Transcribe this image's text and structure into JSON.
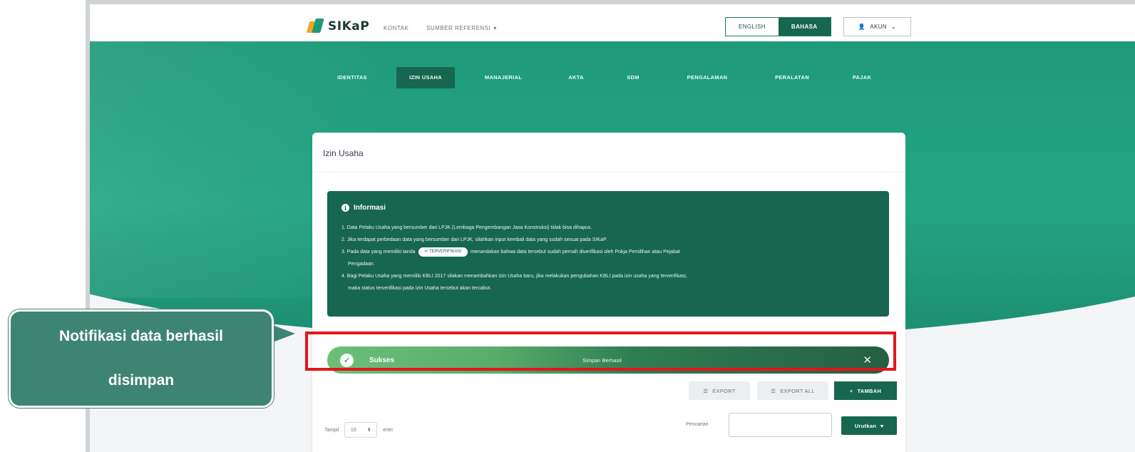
{
  "brand": {
    "name": "SIKaP"
  },
  "topnav": {
    "kontak": "KONTAK",
    "sumber": "SUMBER REFERENSI"
  },
  "language": {
    "english": "ENGLISH",
    "bahasa": "BAHASA"
  },
  "account": {
    "label": "AKUN"
  },
  "tabs": [
    {
      "label": "IDENTITAS",
      "active": false
    },
    {
      "label": "IZIN USAHA",
      "active": true
    },
    {
      "label": "MANAJERIAL",
      "active": false
    },
    {
      "label": "AKTA",
      "active": false
    },
    {
      "label": "SDM",
      "active": false
    },
    {
      "label": "PENGALAMAN",
      "active": false
    },
    {
      "label": "PERALATAN",
      "active": false
    },
    {
      "label": "PAJAK",
      "active": false
    }
  ],
  "card": {
    "title": "Izin Usaha"
  },
  "info": {
    "title": "Informasi",
    "item1": "1. Data Pelaku Usaha yang bersumber dari LPJK (Lembaga Pengembangan Jasa Konstruksi) tidak bisa dihapus.",
    "item2": "2. Jika terdapat perbedaan data yang bersumber dari LPJK, silahkan input kembali data yang sudah sesuai pada SIKaP.",
    "item3a": "3. Pada data yang memiliki tanda",
    "item3_badge": "✔ TERVERIFIKASI",
    "item3b": "menandakan bahwa data tersebut sudah pernah diverifikasi oleh Pokja Pemilihan atau Pejabat",
    "item3c": "Pengadaan.",
    "item4a": "4. Bagi Pelaku Usaha yang memiliki KBLI 2017 silakan menambahkan Izin Usaha baru, jika melakukan pengubahan KBLI pada izin usaha yang terverifikasi,",
    "item4b": "maka status terverifikasi pada Izin Usaha tersebut akan tercabut."
  },
  "alert": {
    "title": "Sukses",
    "message": "Simpan Berhasil"
  },
  "actions": {
    "export": "EXPORT",
    "export_all": "EXPORT ALL",
    "tambah": "TAMBAH"
  },
  "table_controls": {
    "tampil": "Tampil",
    "page_size": "10",
    "suffix": "entri",
    "search_label": "Pencarian",
    "search_value": "",
    "sort": "Urutkan"
  },
  "callout": {
    "line1": "Notifikasi data berhasil",
    "line2": "disimpan"
  },
  "colors": {
    "primary": "#17664f",
    "hero": "#23a584",
    "highlight": "#e5141b",
    "callout": "#3e8472"
  }
}
